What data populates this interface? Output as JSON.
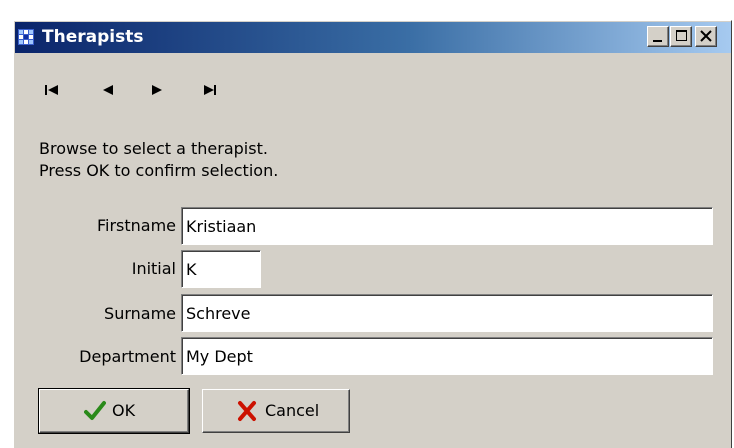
{
  "window": {
    "title": "Therapists",
    "controls": [
      "minimize-icon",
      "maximize-icon",
      "close-icon"
    ]
  },
  "navigator": {
    "buttons": [
      "first-record-icon",
      "prior-record-icon",
      "next-record-icon",
      "last-record-icon"
    ]
  },
  "instructions": {
    "line1": "Browse to select a therapist.",
    "line2": "Press OK to confirm selection."
  },
  "form": {
    "firstname": {
      "label": "Firstname",
      "value": "Kristiaan"
    },
    "initial": {
      "label": "Initial",
      "value": "K"
    },
    "surname": {
      "label": "Surname",
      "value": "Schreve"
    },
    "department": {
      "label": "Department",
      "value": "My Dept"
    }
  },
  "buttons": {
    "ok": {
      "label": "OK",
      "icon": "checkmark-icon"
    },
    "cancel": {
      "label": "Cancel",
      "icon": "x-icon"
    }
  },
  "colors": {
    "titlebar_start": "#0a246a",
    "titlebar_end": "#a6caf0",
    "window_bg": "#d4d0c8",
    "ok_check": "#2a8a1a",
    "cancel_x": "#cc1100"
  }
}
